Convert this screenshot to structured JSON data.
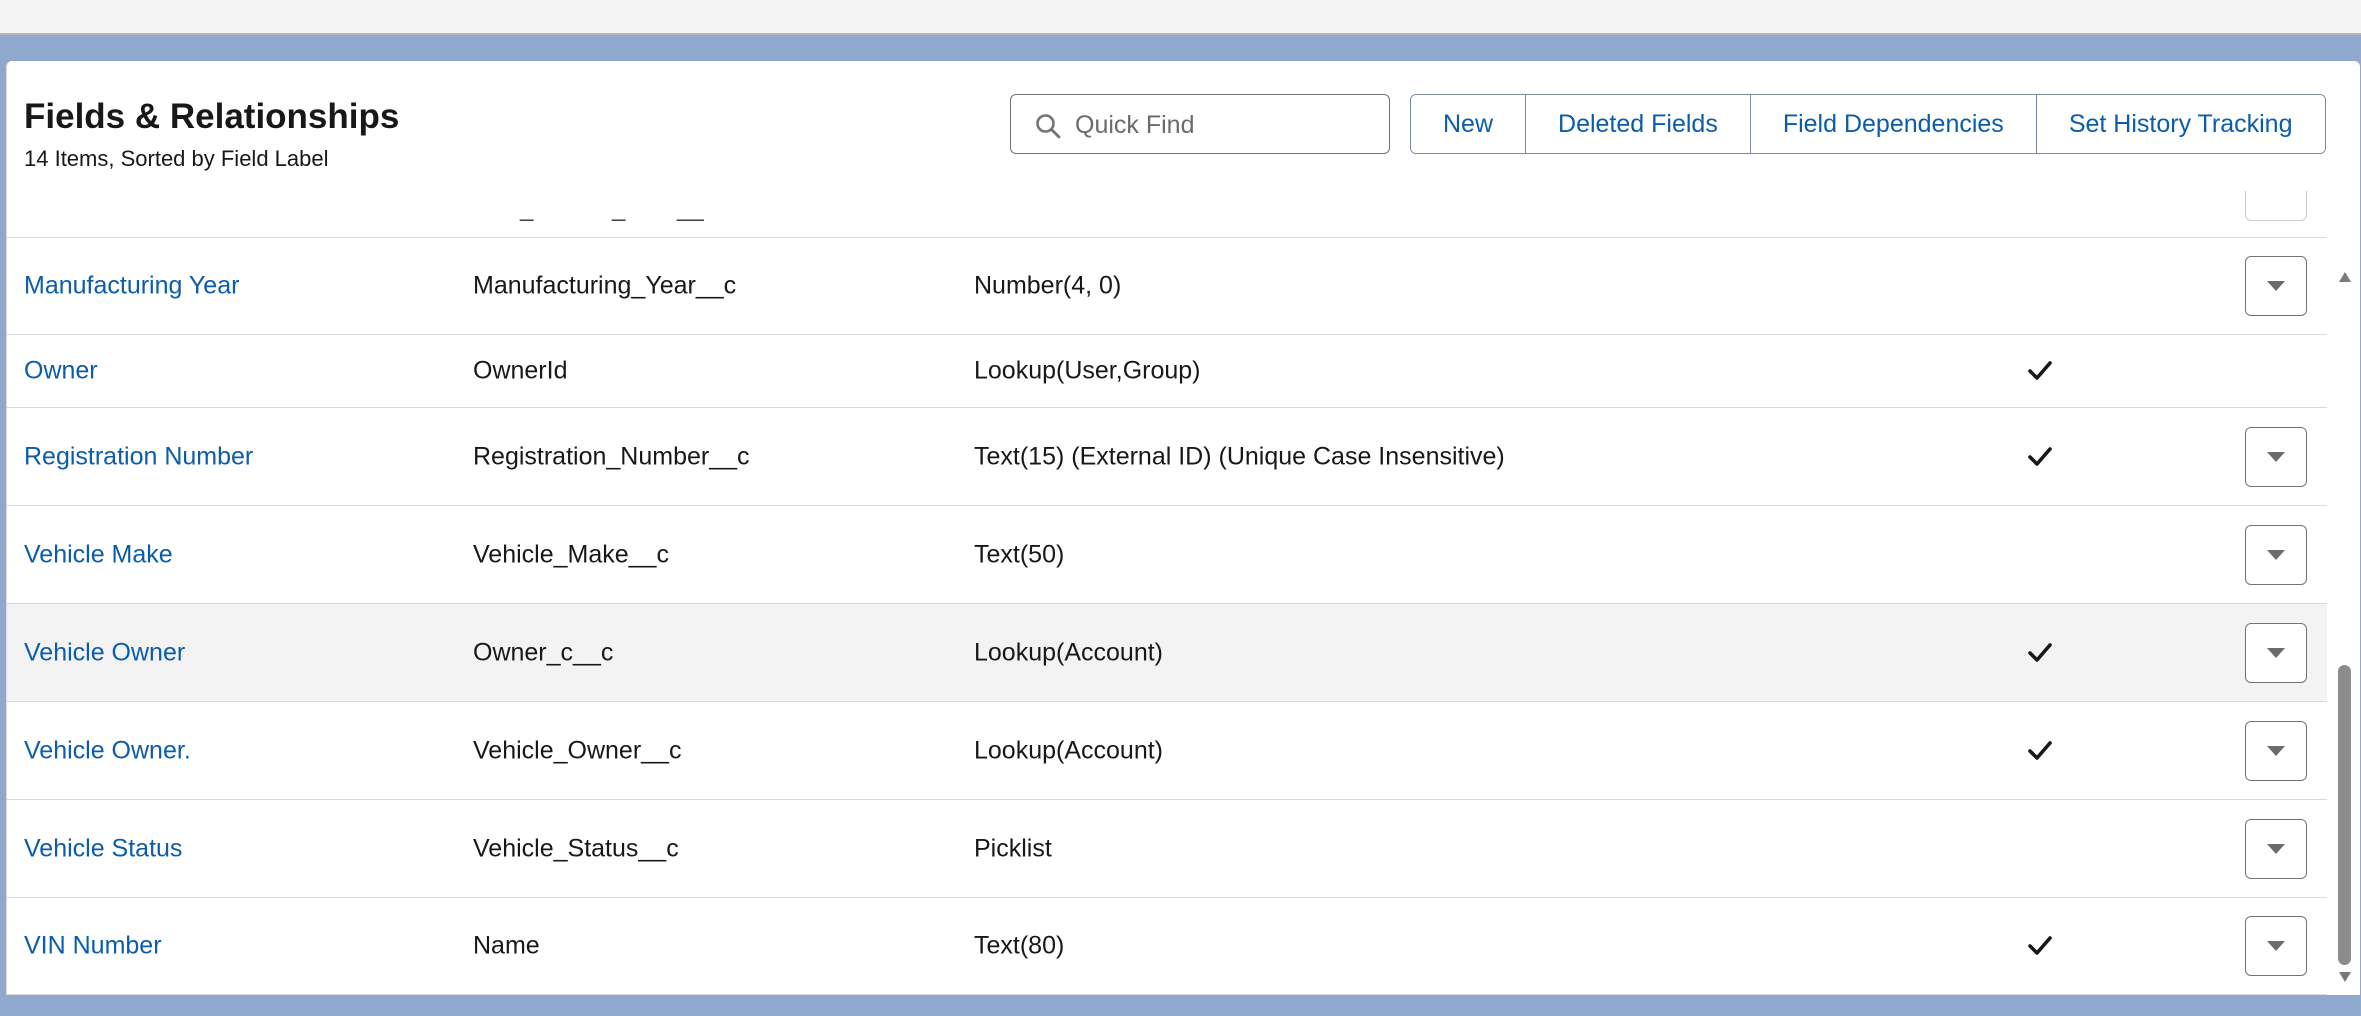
{
  "header": {
    "title": "Fields & Relationships",
    "subtitle": "14 Items, Sorted by Field Label"
  },
  "search": {
    "placeholder": "Quick Find",
    "value": ""
  },
  "buttons": {
    "new": "New",
    "deleted_fields": "Deleted Fields",
    "field_dependencies": "Field Dependencies",
    "set_history_tracking": "Set History Tracking"
  },
  "rows": [
    {
      "label": "Manufacturing Year",
      "api": "Manufacturing_Year__c",
      "type": "Number(4, 0)",
      "indexed": false,
      "has_menu": true
    },
    {
      "label": "Owner",
      "api": "OwnerId",
      "type": "Lookup(User,Group)",
      "indexed": true,
      "has_menu": false
    },
    {
      "label": "Registration Number",
      "api": "Registration_Number__c",
      "type": "Text(15) (External ID) (Unique Case Insensitive)",
      "indexed": true,
      "has_menu": true
    },
    {
      "label": "Vehicle Make",
      "api": "Vehicle_Make__c",
      "type": "Text(50)",
      "indexed": false,
      "has_menu": true
    },
    {
      "label": "Vehicle Owner",
      "api": "Owner_c__c",
      "type": "Lookup(Account)",
      "indexed": true,
      "has_menu": true,
      "highlighted": true
    },
    {
      "label": "Vehicle Owner.",
      "api": "Vehicle_Owner__c",
      "type": "Lookup(Account)",
      "indexed": true,
      "has_menu": true
    },
    {
      "label": "Vehicle Status",
      "api": "Vehicle_Status__c",
      "type": "Picklist",
      "indexed": false,
      "has_menu": true
    },
    {
      "label": "VIN Number",
      "api": "Name",
      "type": "Text(80)",
      "indexed": true,
      "has_menu": true
    }
  ],
  "icons": {
    "search": "search-icon",
    "check": "checkmark-icon",
    "menu": "chevron-down-icon"
  },
  "colors": {
    "link": "#0b5cab",
    "background": "#8fa9ce",
    "row_highlight": "#f3f3f3"
  }
}
